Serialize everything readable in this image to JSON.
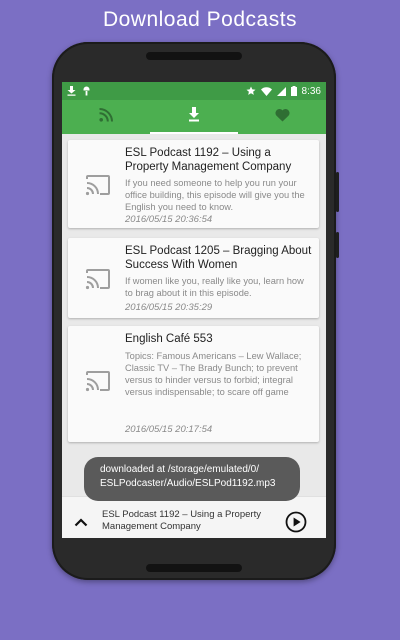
{
  "promo": {
    "title": "Download Podcasts"
  },
  "status_bar": {
    "time": "8:36"
  },
  "tabs": [
    {
      "name": "feeds",
      "icon": "rss-icon",
      "selected": false
    },
    {
      "name": "downloads",
      "icon": "download-icon",
      "selected": true
    },
    {
      "name": "favorites",
      "icon": "heart-icon",
      "selected": false
    }
  ],
  "episodes": [
    {
      "title": "ESL Podcast 1192 – Using a Property Management Company",
      "description": "If you need someone to help you run your office building, this episode will give you the English you need to know.",
      "date": "2016/05/15 20:36:54"
    },
    {
      "title": "ESL Podcast 1205 – Bragging About Success With Women",
      "description": "If women like you, really like you, learn how to brag about it in this episode.",
      "date": "2016/05/15 20:35:29"
    },
    {
      "title": "English Café 553",
      "description": "Topics: Famous Americans – Lew Wallace; Classic TV – The Brady Bunch; to prevent versus to hinder versus to forbid; integral versus indispensable; to scare off game",
      "date": "2016/05/15 20:17:54"
    }
  ],
  "toast": {
    "line1": "downloaded at /storage/emulated/0/",
    "line2": "ESLPodcaster/Audio/ESLPod1192.mp3"
  },
  "player": {
    "title": "ESL Podcast 1192 – Using a Property Management Company"
  },
  "colors": {
    "background": "#7b6fc4",
    "status_bar": "#3f9b46",
    "tab_bar": "#4caf50"
  }
}
